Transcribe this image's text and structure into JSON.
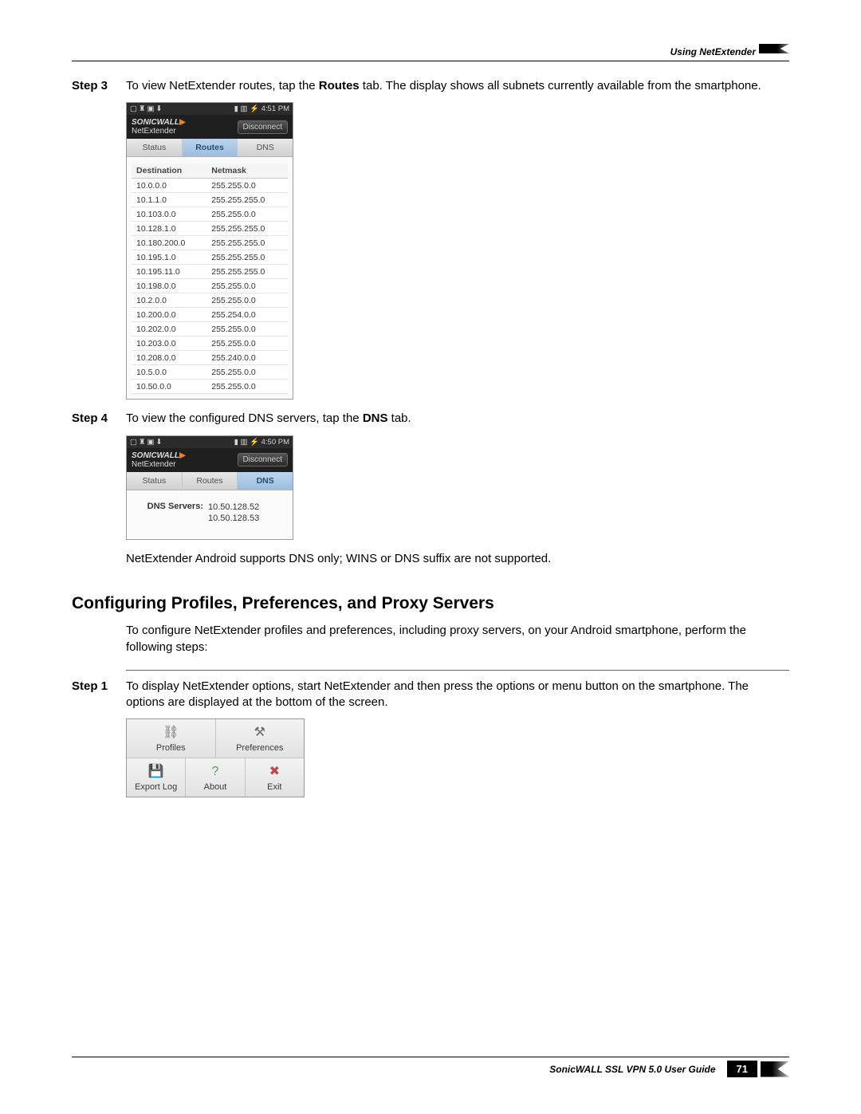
{
  "runningHead": "Using NetExtender",
  "steps": {
    "s3": {
      "label": "Step 3",
      "textA": "To view NetExtender routes, tap the ",
      "bold": "Routes",
      "textB": " tab. The display shows all subnets currently available from the smartphone."
    },
    "s4": {
      "label": "Step 4",
      "textA": "To view the configured DNS servers, tap the ",
      "bold": "DNS",
      "textB": " tab."
    },
    "s1": {
      "label": "Step 1",
      "text": "To display NetExtender options, start NetExtender and then press the options or menu button on the smartphone. The options are displayed at the bottom of the screen."
    }
  },
  "phone1": {
    "time": "4:51 PM",
    "brandTop": "SONICWALL",
    "brandSub": "NetExtender",
    "disconnect": "Disconnect",
    "tabs": {
      "status": "Status",
      "routes": "Routes",
      "dns": "DNS"
    },
    "th": {
      "dest": "Destination",
      "mask": "Netmask"
    },
    "rows": [
      {
        "d": "10.0.0.0",
        "m": "255.255.0.0"
      },
      {
        "d": "10.1.1.0",
        "m": "255.255.255.0"
      },
      {
        "d": "10.103.0.0",
        "m": "255.255.0.0"
      },
      {
        "d": "10.128.1.0",
        "m": "255.255.255.0"
      },
      {
        "d": "10.180.200.0",
        "m": "255.255.255.0"
      },
      {
        "d": "10.195.1.0",
        "m": "255.255.255.0"
      },
      {
        "d": "10.195.11.0",
        "m": "255.255.255.0"
      },
      {
        "d": "10.198.0.0",
        "m": "255.255.0.0"
      },
      {
        "d": "10.2.0.0",
        "m": "255.255.0.0"
      },
      {
        "d": "10.200.0.0",
        "m": "255.254.0.0"
      },
      {
        "d": "10.202.0.0",
        "m": "255.255.0.0"
      },
      {
        "d": "10.203.0.0",
        "m": "255.255.0.0"
      },
      {
        "d": "10.208.0.0",
        "m": "255.240.0.0"
      },
      {
        "d": "10.5.0.0",
        "m": "255.255.0.0"
      },
      {
        "d": "10.50.0.0",
        "m": "255.255.0.0"
      }
    ]
  },
  "phone2": {
    "time": "4:50 PM",
    "brandTop": "SONICWALL",
    "brandSub": "NetExtender",
    "disconnect": "Disconnect",
    "tabs": {
      "status": "Status",
      "routes": "Routes",
      "dns": "DNS"
    },
    "dnsLabel": "DNS Servers:",
    "dns1": "10.50.128.52",
    "dns2": "10.50.128.53"
  },
  "note": "NetExtender Android supports DNS only; WINS or DNS suffix are not supported.",
  "sectionTitle": "Configuring Profiles, Preferences, and Proxy Servers",
  "sectionIntro": "To configure NetExtender profiles and preferences, including proxy servers, on your Android smartphone, perform the following steps:",
  "menu": {
    "profiles": "Profiles",
    "preferences": "Preferences",
    "exportLog": "Export Log",
    "about": "About",
    "exit": "Exit"
  },
  "footer": {
    "title": "SonicWALL SSL VPN 5.0 User Guide",
    "page": "71"
  }
}
